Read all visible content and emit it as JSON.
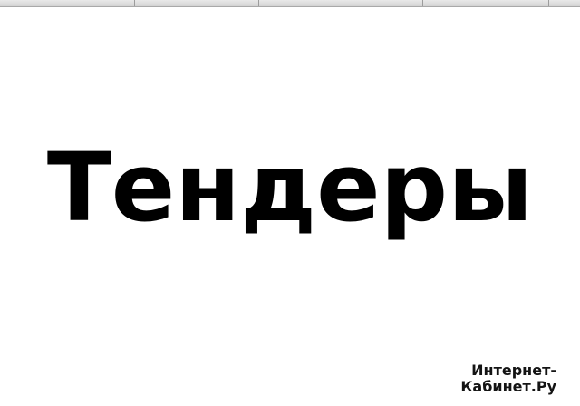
{
  "main": {
    "headline": "Тендеры"
  },
  "watermark": {
    "line1": "Интернет-",
    "line2": "Кабинет.Ру"
  },
  "colors": {
    "background": "#ffffff",
    "text": "#000000",
    "toolbar": "#d8d8d8"
  }
}
